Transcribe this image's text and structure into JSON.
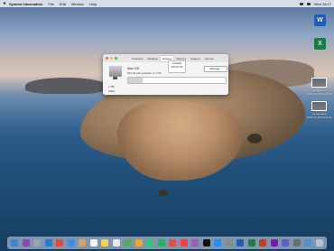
{
  "menubar": {
    "apple": "",
    "app_name": "System Information",
    "items": [
      "File",
      "Edit",
      "Window",
      "Help"
    ],
    "clock": "Wed 18:17"
  },
  "window": {
    "tabs": [
      "Overview",
      "Displays",
      "Storage",
      "Memory",
      "Support",
      "Service"
    ],
    "active_tab": "Storage",
    "disk": {
      "name": "Mac OS",
      "detail": "849,06 GB available of 1 TB",
      "capacity_total": "1 TB",
      "capacity_free": "Flash",
      "used_fraction": 0.15
    },
    "tooltip_title": "Available",
    "tooltip_value": "849,06 GB",
    "manage_label": "Manage..."
  },
  "desktop": {
    "icons": [
      {
        "label": "",
        "kind": "word-icon",
        "letter": "W"
      },
      {
        "label": "",
        "kind": "excel-icon",
        "letter": "X"
      },
      {
        "label1": "Screenshot",
        "label2": "2020-11-18-13.45.08",
        "kind": "screenshot-icon"
      },
      {
        "label1": "Screenshot",
        "label2": "2020-11-18-13.46.21",
        "kind": "screenshot-icon"
      }
    ]
  },
  "dock": {
    "apps": [
      "finder-icon",
      "siri-icon",
      "launchpad-icon",
      "safari-icon",
      "chrome-icon",
      "mail-icon",
      "contacts-icon",
      "calendar-icon",
      "notes-icon",
      "reminders-icon",
      "maps-icon",
      "photos-icon",
      "messages-icon",
      "facetime-icon",
      "news-icon",
      "music-icon",
      "podcasts-icon",
      "tv-icon",
      "appstore-icon",
      "preferences-icon",
      "word-icon",
      "excel-icon",
      "powerpoint-icon",
      "onenote-icon",
      "teams-icon",
      "system-info-icon",
      "downloads-icon",
      "trash-icon"
    ],
    "colors": [
      "#3a84d8",
      "#8e44ad",
      "#9aa3ad",
      "#2b78d9",
      "#e8453c",
      "#3b8eea",
      "#d9a066",
      "#f2f2f2",
      "#f7d24a",
      "#e9e9e9",
      "#5aa95a",
      "#f5a623",
      "#2ecc71",
      "#27ae60",
      "#e74c3c",
      "#fc3c44",
      "#9b59b6",
      "#111111",
      "#1e90ff",
      "#8a8a8a",
      "#1f5db6",
      "#1d7b44",
      "#c43e1c",
      "#7719aa",
      "#5b5fc7",
      "#6d6d6d",
      "#4a90d9",
      "#b8c2cc"
    ]
  }
}
